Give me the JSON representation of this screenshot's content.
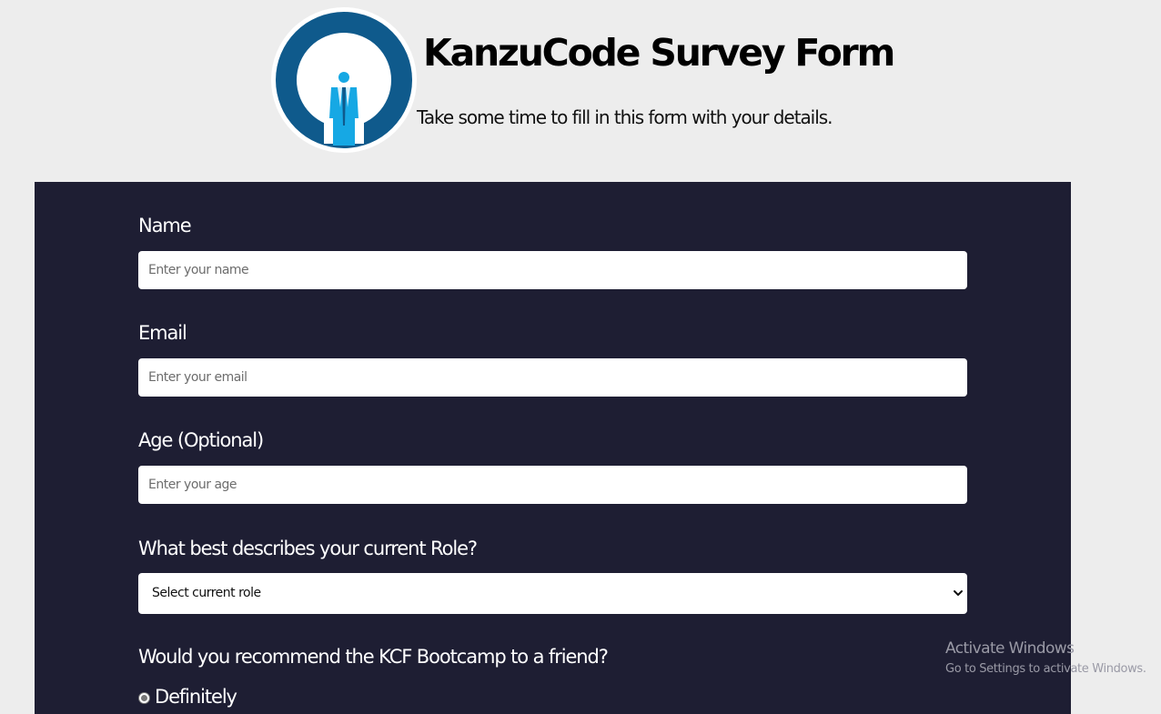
{
  "header": {
    "title": "KanzuCode Survey Form",
    "subtitle": "Take some time to fill in this form with your details."
  },
  "form": {
    "name": {
      "label": "Name",
      "placeholder": "Enter your name",
      "value": ""
    },
    "email": {
      "label": "Email",
      "placeholder": "Enter your email",
      "value": ""
    },
    "age": {
      "label": "Age (Optional)",
      "placeholder": "Enter your age",
      "value": ""
    },
    "role": {
      "label": "What best describes your current Role?",
      "selected": "Select current role"
    },
    "recommend": {
      "label": "Would you recommend the KCF Bootcamp to a friend?",
      "options": [
        {
          "label": "Definitely",
          "checked": true
        }
      ]
    }
  },
  "watermark": {
    "title": "Activate Windows",
    "subtitle": "Go to Settings to activate Windows."
  },
  "icons": {
    "logo": "person-in-circle-logo",
    "select": "chevron-down-icon",
    "radio": "radio-button-checked"
  },
  "colors": {
    "page_background": "#ededed",
    "form_background": "#1e1e33",
    "logo_ring": "#0f5a8c",
    "logo_figure": "#16a8e4"
  }
}
